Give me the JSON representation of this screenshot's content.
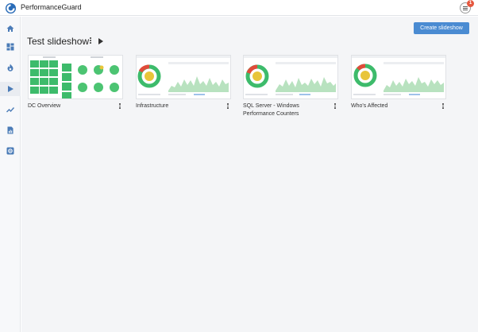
{
  "app": {
    "brand": "PerformanceGuard",
    "notifications": "1"
  },
  "sidebar": {
    "items": [
      {
        "icon": "home-icon"
      },
      {
        "icon": "dashboard-icon"
      },
      {
        "icon": "fire-icon"
      },
      {
        "icon": "play-icon",
        "active": true
      },
      {
        "icon": "trend-icon"
      },
      {
        "icon": "report-icon"
      },
      {
        "icon": "settings-icon"
      }
    ]
  },
  "header": {
    "title": "Test slideshow",
    "create_label": "Create slideshow"
  },
  "slides": [
    {
      "label": "DC Overview"
    },
    {
      "label": "Infrastructure"
    },
    {
      "label": "SQL Server - Windows Performance Counters"
    },
    {
      "label": "Who's Affected"
    }
  ],
  "colors": {
    "accent": "#4a8bd2",
    "badge": "#e5573e",
    "ok": "#3dbb6b",
    "warn": "#e8c53a",
    "crit": "#e04b3a"
  }
}
